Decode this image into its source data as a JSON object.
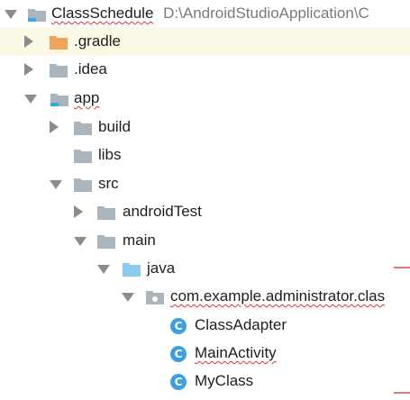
{
  "project": {
    "name": "ClassSchedule",
    "path": "D:\\AndroidStudioApplication\\C"
  },
  "nodes": {
    "gradle": ".gradle",
    "idea": ".idea",
    "app": "app",
    "build": "build",
    "libs": "libs",
    "src": "src",
    "androidTest": "androidTest",
    "main": "main",
    "java": "java",
    "package": "com.example.administrator.clas",
    "classes": [
      "ClassAdapter",
      "MainActivity",
      "MyClass"
    ]
  },
  "class_icon_letter": "C",
  "colors": {
    "folder": "#a9b4bd",
    "folder_gradle": "#f0a35c",
    "folder_java": "#8ccbee",
    "class_icon": "#3d9fdf",
    "module_badge": "#35a8e0",
    "highlight_row": "#fcf9e6",
    "spell_underline": "#e03030"
  },
  "icons": {
    "project": "module-folder-icon",
    "folder": "folder-icon",
    "source_root": "source-folder-icon",
    "package": "package-icon",
    "class": "class-icon"
  }
}
